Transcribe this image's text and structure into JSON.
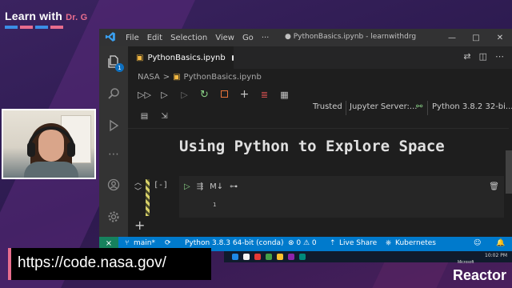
{
  "brand": {
    "text": "Learn with",
    "dr": "Dr. G",
    "bar_colors": [
      "#3b8ee6",
      "#e86d8e",
      "#3b8ee6",
      "#e86d8e"
    ]
  },
  "window": {
    "logo": "vscode-logo",
    "menu": [
      "File",
      "Edit",
      "Selection",
      "View",
      "Go",
      "···"
    ],
    "title": "● PythonBasics.ipynb - learnwithdrg",
    "controls": [
      "—",
      "□",
      "✕"
    ]
  },
  "activity_bar": {
    "badge": "1",
    "icons": [
      "explorer-icon",
      "search-icon",
      "run-debug-icon",
      "more-icon",
      "account-icon",
      "settings-icon"
    ]
  },
  "tabs": [
    {
      "label": "PythonBasics.ipynb",
      "modified": true
    }
  ],
  "breadcrumb": [
    "NASA",
    ">",
    "PythonBasics.ipynb"
  ],
  "notebook_toolbar": {
    "tools": [
      "run-all-icon",
      "run-above-icon",
      "run-below-icon",
      "restart-icon",
      "interrupt-icon",
      "add-cell-icon",
      "clear-outputs-icon",
      "variables-icon"
    ],
    "extra": [
      "save-icon",
      "export-icon"
    ]
  },
  "kernel_bar": {
    "trusted": "Trusted",
    "server": "Jupyter Server:...",
    "kernel": "Python 3.8.2 32-bi..."
  },
  "markdown_cell": {
    "heading": "Using Python to Explore Space"
  },
  "code_cell": {
    "exec_count": "[-]",
    "markdown_toggle": "M↓",
    "line_number": "1"
  },
  "statusbar": {
    "remote": "⨯",
    "branch": "main*",
    "sync": "⟳",
    "interpreter": "Python 3.8.3 64-bit (conda)",
    "problems": "⊗ 0 ⚠ 0",
    "live_share": "Live Share",
    "kubernetes": "Kubernetes"
  },
  "overlay": {
    "url": "https://code.nasa.gov/",
    "sub": "Microsoft",
    "logo": "Reactor"
  },
  "taskbar": {
    "icon_colors": [
      "#1e88e5",
      "#f3f3f3",
      "#e53935",
      "#43a047",
      "#fbc02d",
      "#8e24aa",
      "#00897b"
    ],
    "clock": "10:02 PM"
  },
  "colors": {
    "accent": "#007acc",
    "brand_pink": "#e86d8e",
    "editor_bg": "#1e1e1e"
  }
}
